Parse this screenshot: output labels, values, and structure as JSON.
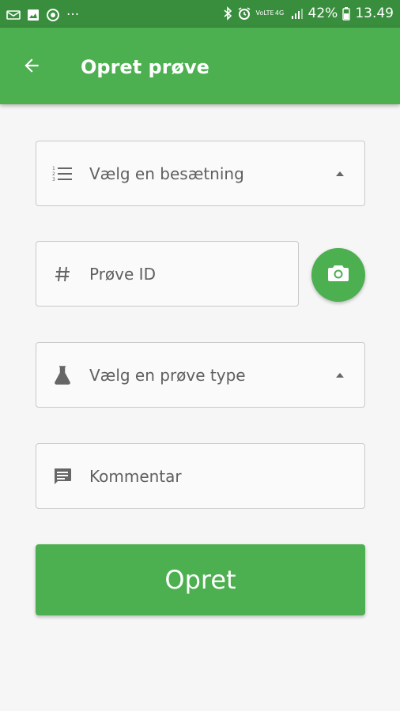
{
  "status_bar": {
    "overflow_dots": "···",
    "volte_top": "VoLTE",
    "network_top": "4G",
    "battery_percent": "42%",
    "time": "13.49",
    "icons": [
      "mail-icon",
      "image-icon",
      "sync-icon",
      "bluetooth-icon",
      "alarm-icon",
      "signal-icon",
      "battery-icon"
    ]
  },
  "app_bar": {
    "title": "Opret prøve",
    "back_icon": "arrow-left-icon"
  },
  "form": {
    "herd_select": {
      "placeholder": "Vælg en besætning",
      "icon": "list-numbered-icon",
      "arrow": "triangle-up-icon"
    },
    "sample_id": {
      "placeholder": "Prøve ID",
      "icon": "hash-icon"
    },
    "camera": {
      "icon": "camera-icon"
    },
    "sample_type_select": {
      "placeholder": "Vælg en prøve type",
      "icon": "flask-icon",
      "arrow": "triangle-up-icon"
    },
    "comment": {
      "placeholder": "Kommentar",
      "icon": "comment-icon"
    },
    "submit_label": "Opret"
  },
  "colors": {
    "primary": "#4caf50",
    "primary_dark": "#388e3c",
    "field_border": "#c9c9c9",
    "field_text": "#5f5f5f",
    "icon_gray": "#666666",
    "background": "#f6f6f6"
  }
}
